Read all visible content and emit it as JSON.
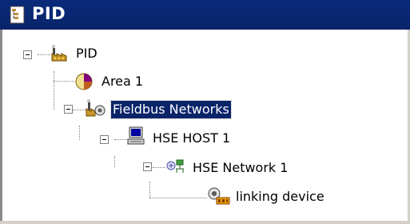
{
  "window": {
    "title": "PID",
    "icon": "tree-doc-icon"
  },
  "tree": {
    "root": {
      "label": "PID",
      "icon": "factory-icon",
      "expanded": true
    },
    "area": {
      "label": "Area 1",
      "icon": "area-pie-icon"
    },
    "fieldbus": {
      "label": "Fieldbus Networks",
      "icon": "factory-network-icon",
      "expanded": true,
      "selected": true
    },
    "host": {
      "label": "HSE HOST 1",
      "icon": "computer-icon",
      "expanded": true
    },
    "network": {
      "label": "HSE Network 1",
      "icon": "network-icon",
      "expanded": true
    },
    "device": {
      "label": "linking device",
      "icon": "linking-device-icon"
    }
  },
  "colors": {
    "titlebar": "#0a246a",
    "selection": "#0a246a"
  }
}
